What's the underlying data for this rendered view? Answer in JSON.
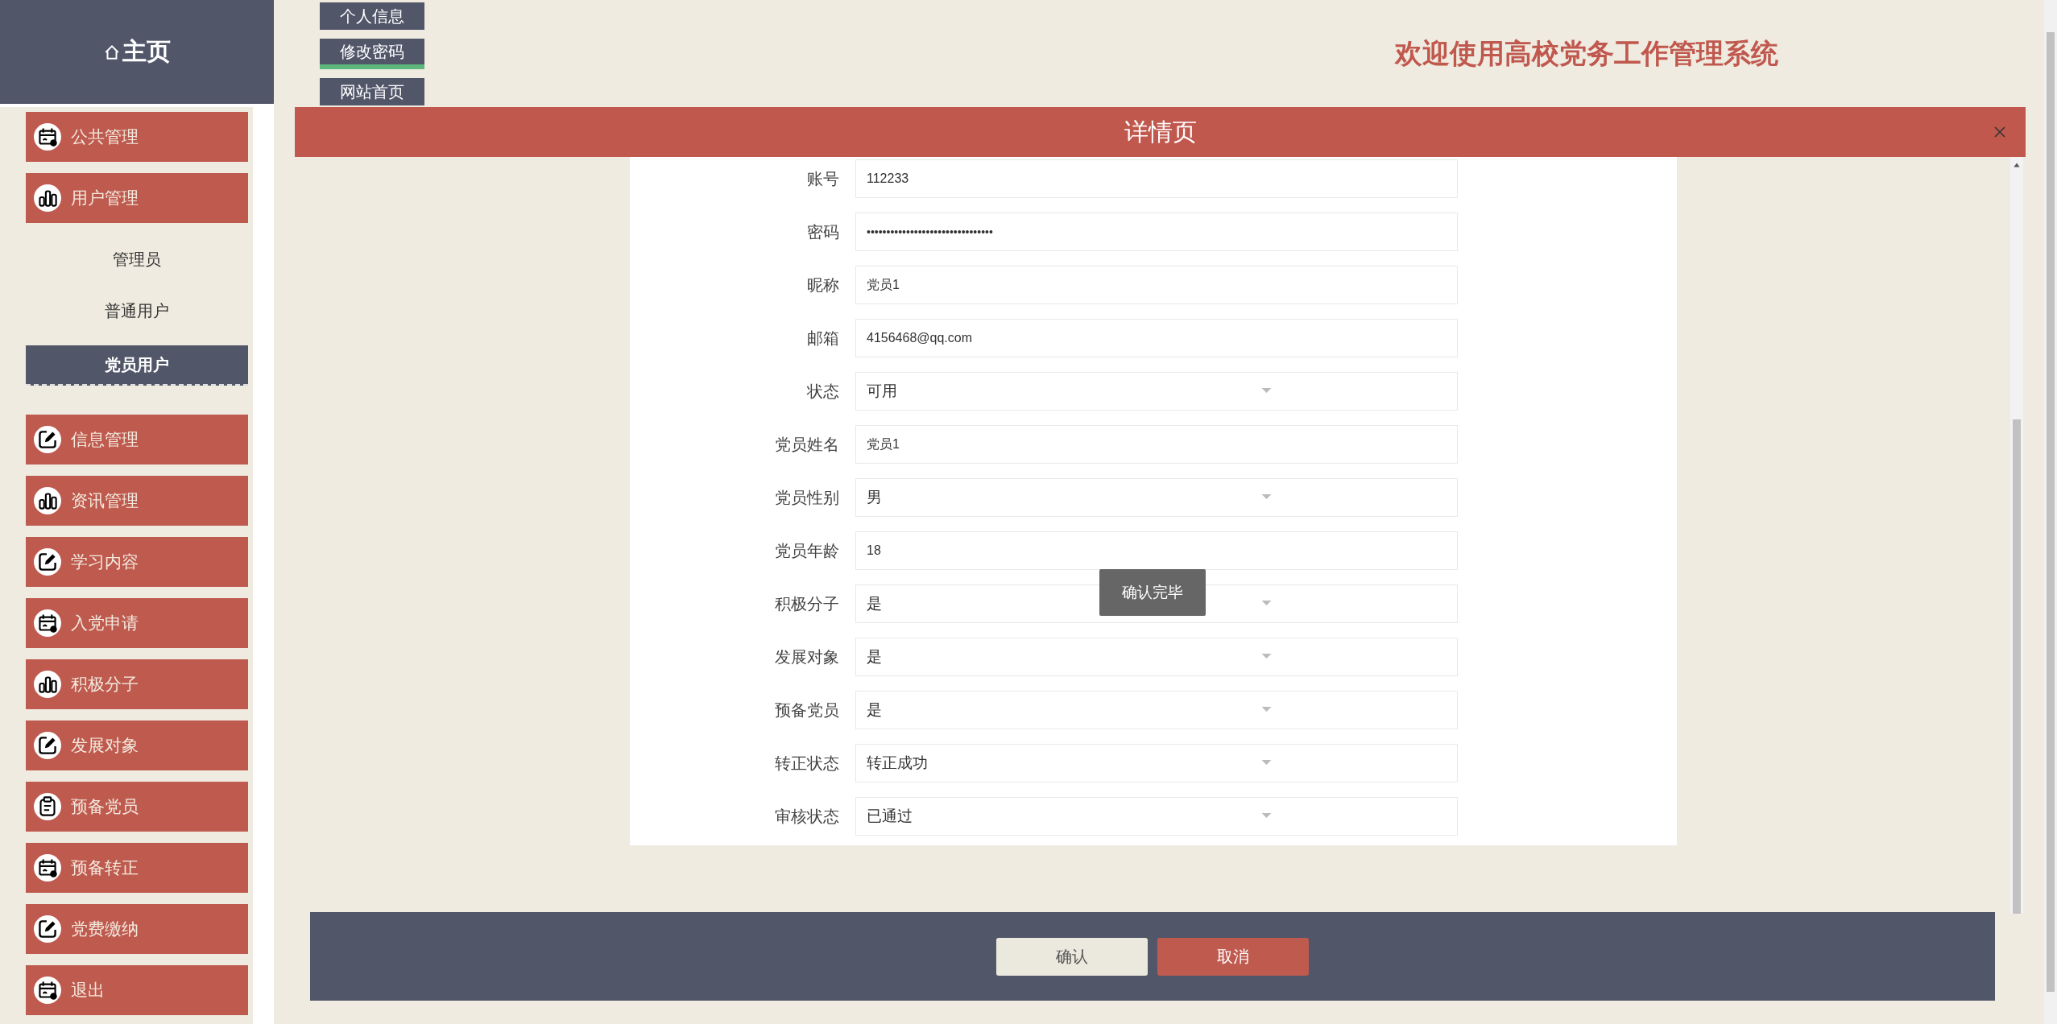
{
  "logo": {
    "label": "主页"
  },
  "top_nav": [
    {
      "label": "个人信息",
      "selected": false
    },
    {
      "label": "修改密码",
      "selected": true
    },
    {
      "label": "网站首页",
      "selected": false
    }
  ],
  "header": {
    "title": "欢迎使用高校党务工作管理系统"
  },
  "sidebar": {
    "items": [
      {
        "label": "公共管理",
        "kind": "calendar"
      },
      {
        "label": "用户管理",
        "kind": "chart",
        "children": [
          {
            "label": "管理员",
            "selected": false
          },
          {
            "label": "普通用户",
            "selected": false
          },
          {
            "label": "党员用户",
            "selected": true
          }
        ]
      },
      {
        "label": "信息管理",
        "kind": "edit"
      },
      {
        "label": "资讯管理",
        "kind": "chart"
      },
      {
        "label": "学习内容",
        "kind": "edit"
      },
      {
        "label": "入党申请",
        "kind": "calendar"
      },
      {
        "label": "积极分子",
        "kind": "chart"
      },
      {
        "label": "发展对象",
        "kind": "edit"
      },
      {
        "label": "预备党员",
        "kind": "clipboard"
      },
      {
        "label": "预备转正",
        "kind": "calendar"
      },
      {
        "label": "党费缴纳",
        "kind": "edit"
      },
      {
        "label": "退出",
        "kind": "calendar"
      }
    ]
  },
  "dialog": {
    "title": "详情页",
    "fields": [
      {
        "label": "账号",
        "kind": "text",
        "value": "112233"
      },
      {
        "label": "密码",
        "kind": "password",
        "value": "••••••••••••••••••••••••••••••••"
      },
      {
        "label": "昵称",
        "kind": "text",
        "value": "党员1"
      },
      {
        "label": "邮箱",
        "kind": "text",
        "value": "4156468@qq.com"
      },
      {
        "label": "状态",
        "kind": "select",
        "value": "可用"
      },
      {
        "label": "党员姓名",
        "kind": "text",
        "value": "党员1"
      },
      {
        "label": "党员性别",
        "kind": "select",
        "value": "男"
      },
      {
        "label": "党员年龄",
        "kind": "text",
        "value": "18"
      },
      {
        "label": "积极分子",
        "kind": "select",
        "value": "是"
      },
      {
        "label": "发展对象",
        "kind": "select",
        "value": "是"
      },
      {
        "label": "预备党员",
        "kind": "select",
        "value": "是"
      },
      {
        "label": "转正状态",
        "kind": "select",
        "value": "转正成功"
      },
      {
        "label": "审核状态",
        "kind": "select",
        "value": "已通过"
      }
    ],
    "tooltip": "确认完毕",
    "buttons": [
      {
        "label": "确认",
        "kind": "confirm"
      },
      {
        "label": "取消",
        "kind": "cancel"
      }
    ]
  }
}
